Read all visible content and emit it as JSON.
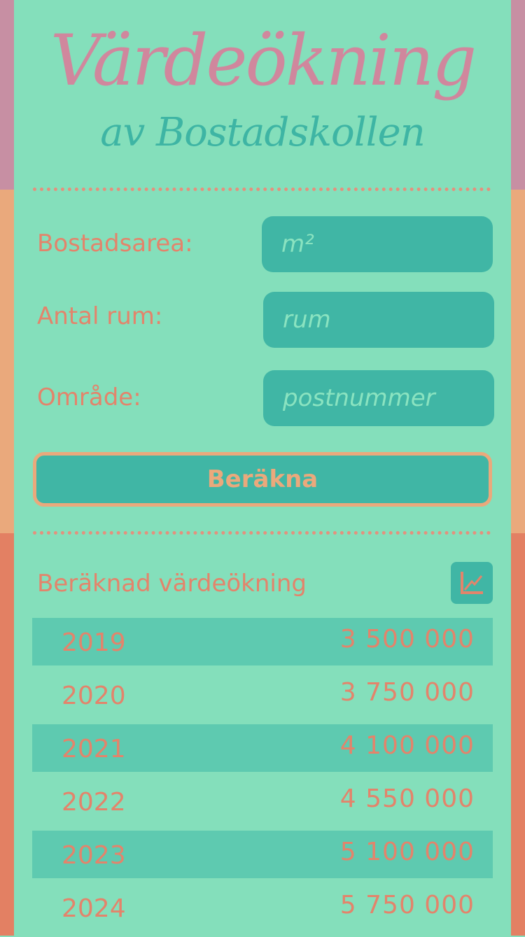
{
  "header": {
    "title": "Värdeökning",
    "subtitle": "av Bostadskollen"
  },
  "form": {
    "area_label": "Bostadsarea:",
    "area_placeholder": "m²",
    "rooms_label": "Antal rum:",
    "rooms_placeholder": "rum",
    "region_label": "Område:",
    "region_placeholder": "postnummer",
    "submit_label": "Beräkna"
  },
  "results": {
    "label": "Beräknad värdeökning",
    "chart_icon": "chart-icon",
    "rows": [
      {
        "year": "2019",
        "value": "3 500 000"
      },
      {
        "year": "2020",
        "value": "3 750 000"
      },
      {
        "year": "2021",
        "value": "4 100 000"
      },
      {
        "year": "2022",
        "value": "4 550 000"
      },
      {
        "year": "2023",
        "value": "5 100 000"
      },
      {
        "year": "2024",
        "value": "5 750 000"
      }
    ]
  },
  "colors": {
    "background": "#84dfbb",
    "teal": "#40b6a5",
    "coral": "#e3846b",
    "pink": "#d0879d",
    "peach": "#eaa97c"
  }
}
